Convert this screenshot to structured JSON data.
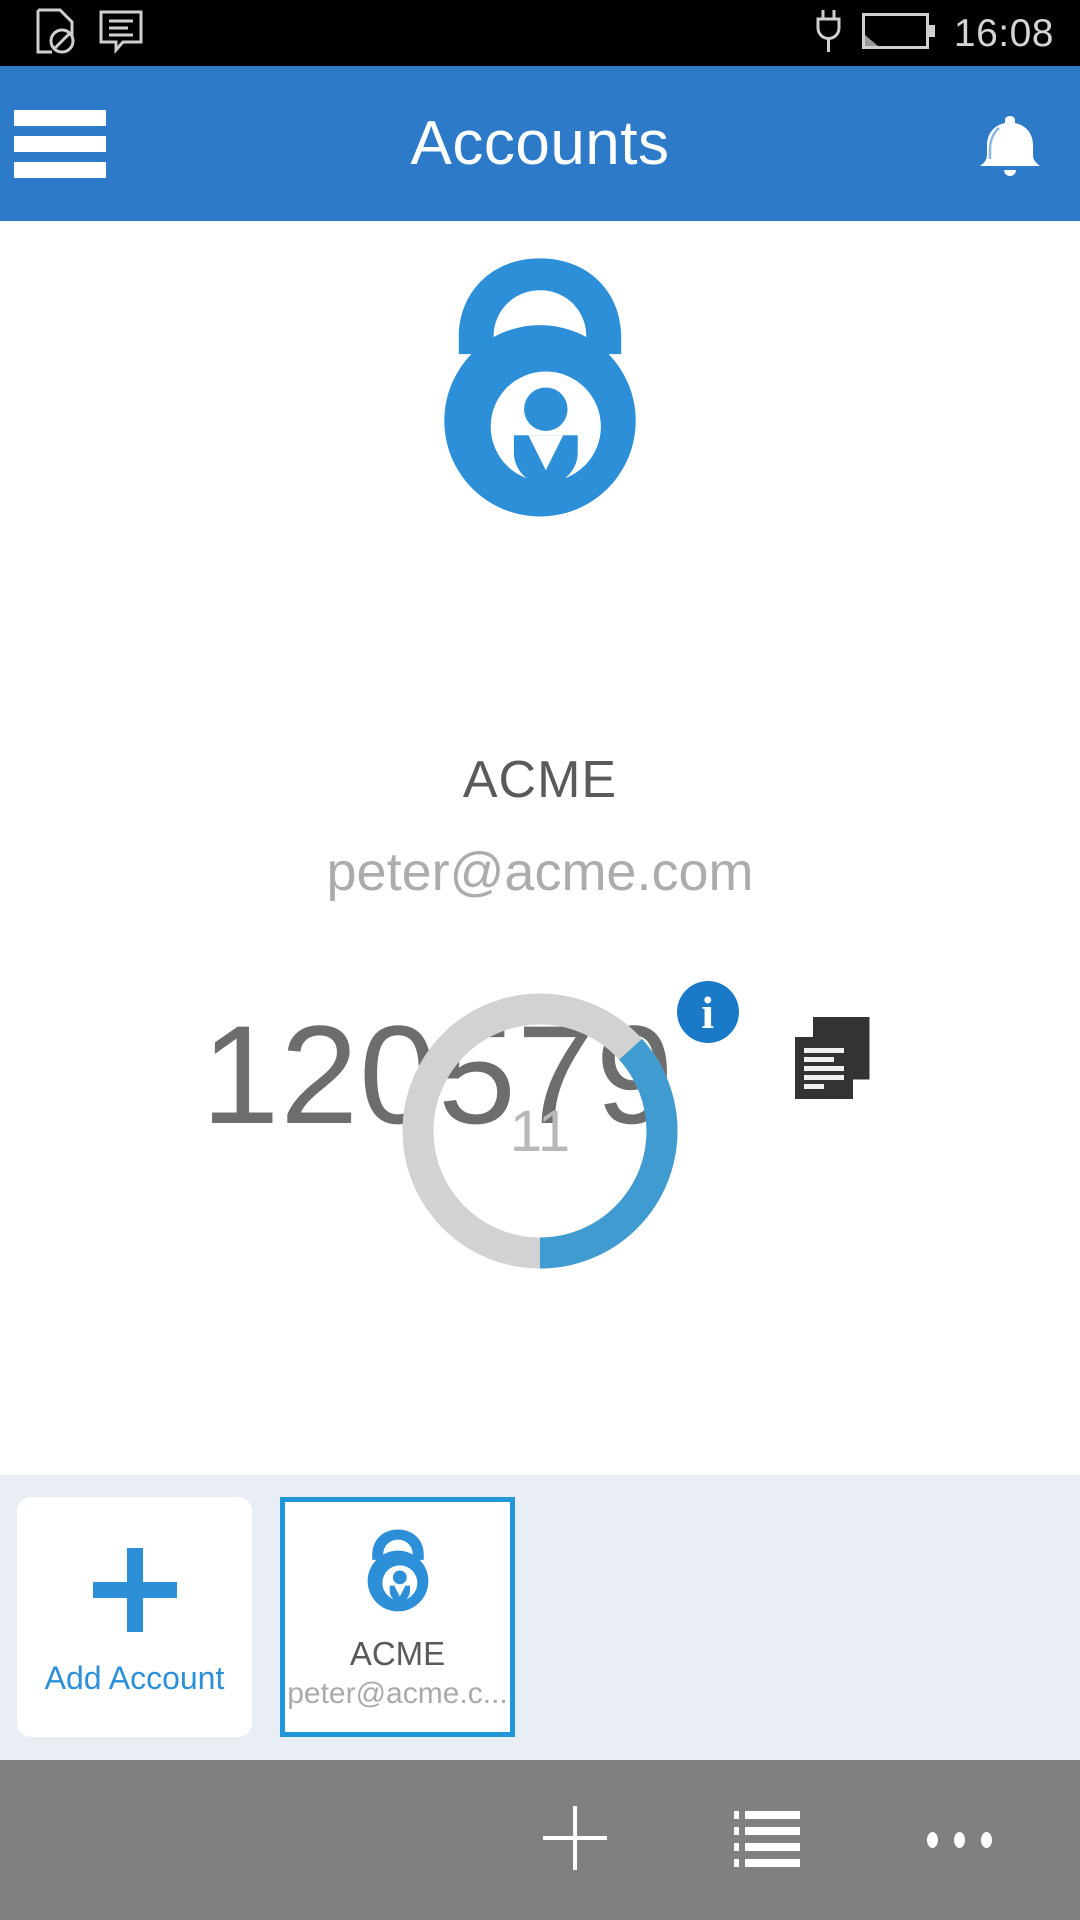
{
  "statusbar": {
    "time": "16:08",
    "icons": [
      "document-blocked-icon",
      "message-icon",
      "charging-plug-icon",
      "battery-icon"
    ]
  },
  "appbar": {
    "title": "Accounts",
    "menu_icon": "hamburger-menu-icon",
    "notification_icon": "bell-icon",
    "background_color": "#2d7ac9"
  },
  "account": {
    "logo_icon": "padlock-user-logo",
    "name": "ACME",
    "email": "peter@acme.com",
    "otp_code": "120579",
    "info_badge": "i",
    "copy_icon": "copy-icon"
  },
  "countdown": {
    "seconds_remaining": "11",
    "total_seconds": 30,
    "arc_color": "#3f9bd0",
    "track_color": "#d2d2d2"
  },
  "tray": {
    "background_color": "#e9edf4",
    "add_tile": {
      "label": "Add Account",
      "icon": "plus-icon",
      "accent_color": "#2d8fd8"
    },
    "accounts": [
      {
        "name": "ACME",
        "email": "peter@acme.c...",
        "icon": "padlock-user-logo",
        "selected": true,
        "selected_border_color": "#2196d9"
      }
    ]
  },
  "bottomnav": {
    "background_color": "#808080",
    "buttons": [
      {
        "name": "add",
        "icon": "plus-icon"
      },
      {
        "name": "list",
        "icon": "list-icon"
      },
      {
        "name": "more",
        "icon": "more-dots-icon"
      }
    ]
  }
}
